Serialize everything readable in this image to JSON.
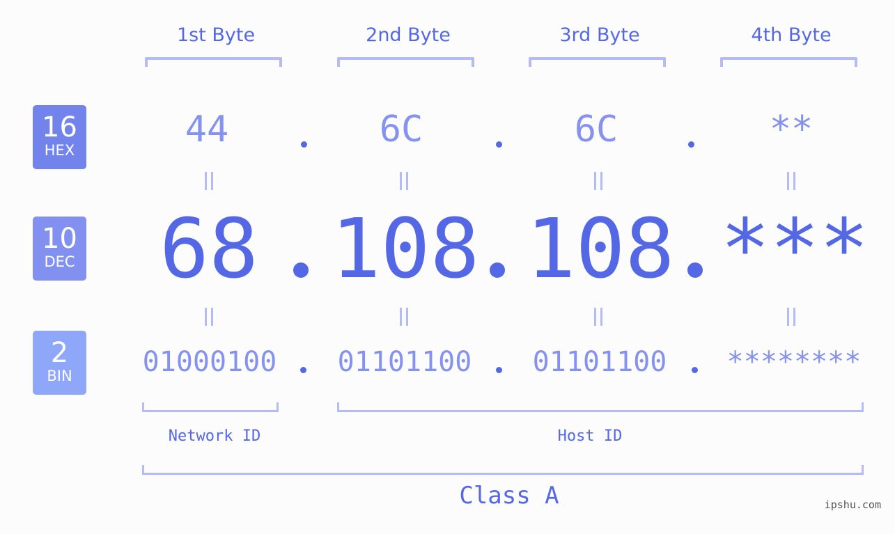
{
  "bases": [
    {
      "number": "16",
      "label": "HEX",
      "color": "#7383ec"
    },
    {
      "number": "10",
      "label": "DEC",
      "color": "#8291f0"
    },
    {
      "number": "2",
      "label": "BIN",
      "color": "#8fa7f8"
    }
  ],
  "bytes": [
    {
      "header": "1st Byte",
      "hex": "44",
      "dec": "68",
      "bin": "01000100"
    },
    {
      "header": "2nd Byte",
      "hex": "6C",
      "dec": "108",
      "bin": "01101100"
    },
    {
      "header": "3rd Byte",
      "hex": "6C",
      "dec": "108",
      "bin": "01101100"
    },
    {
      "header": "4th Byte",
      "hex": "**",
      "dec": "***",
      "bin": "********"
    }
  ],
  "separator": ".",
  "network_id_label": "Network ID",
  "host_id_label": "Host ID",
  "class_label": "Class A",
  "watermark": "ipshu.com",
  "colors": {
    "primary": "#5468e6",
    "secondary": "#8592ee",
    "bracket": "#b3bcf6",
    "background": "#fbfcfb"
  }
}
